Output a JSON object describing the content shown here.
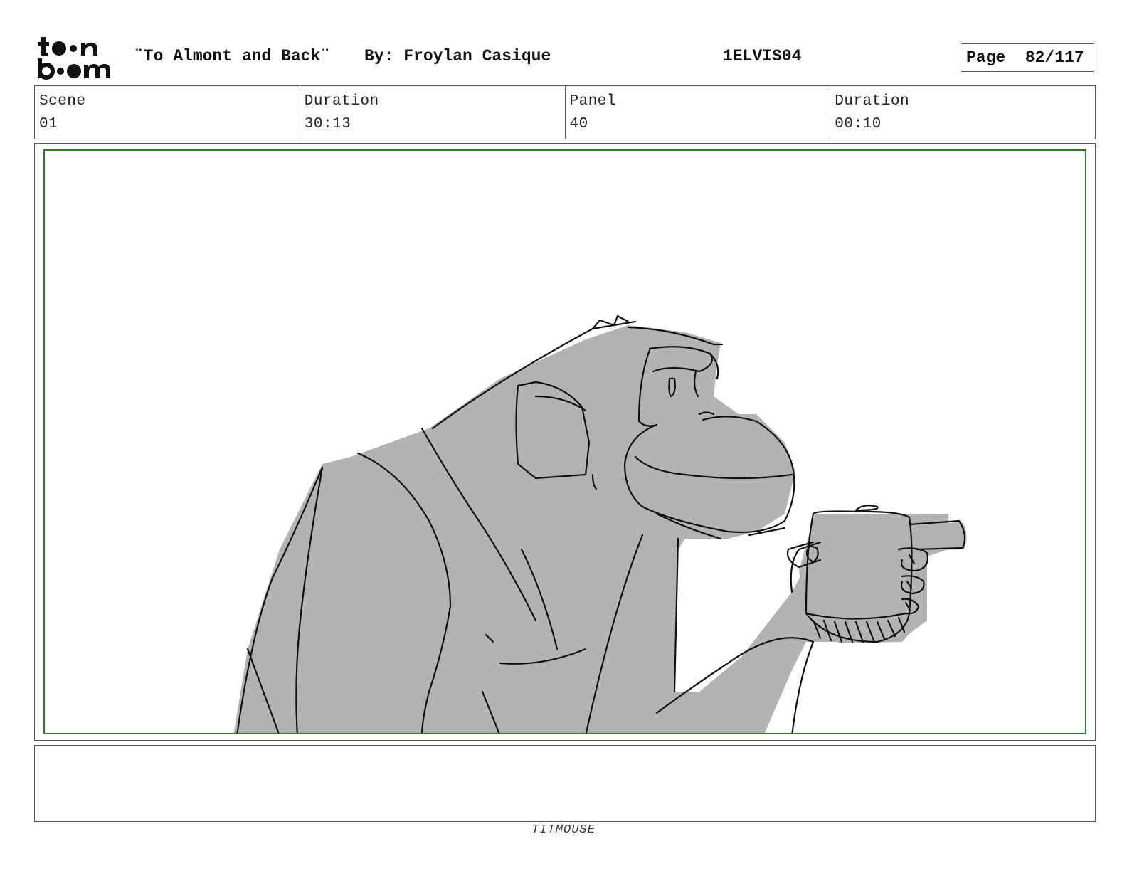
{
  "header": {
    "logo_text": "toonboom",
    "title": "¨To Almont and Back¨",
    "author": "By: Froylan Casique",
    "episode_code": "1ELVIS04",
    "page_label": "Page",
    "page_number": "82/117"
  },
  "info": {
    "scene_label": "Scene",
    "scene_value": "01",
    "duration_label": "Duration",
    "duration_value": "30:13",
    "panel_label": "Panel",
    "panel_value": "40",
    "panel_duration_label": "Duration",
    "panel_duration_value": "00:10"
  },
  "colors": {
    "safe_frame": "#2f7a2f",
    "fill_gray": "#b3b3b3"
  },
  "notes": "",
  "footer": {
    "studio": "TITMOUSE"
  }
}
